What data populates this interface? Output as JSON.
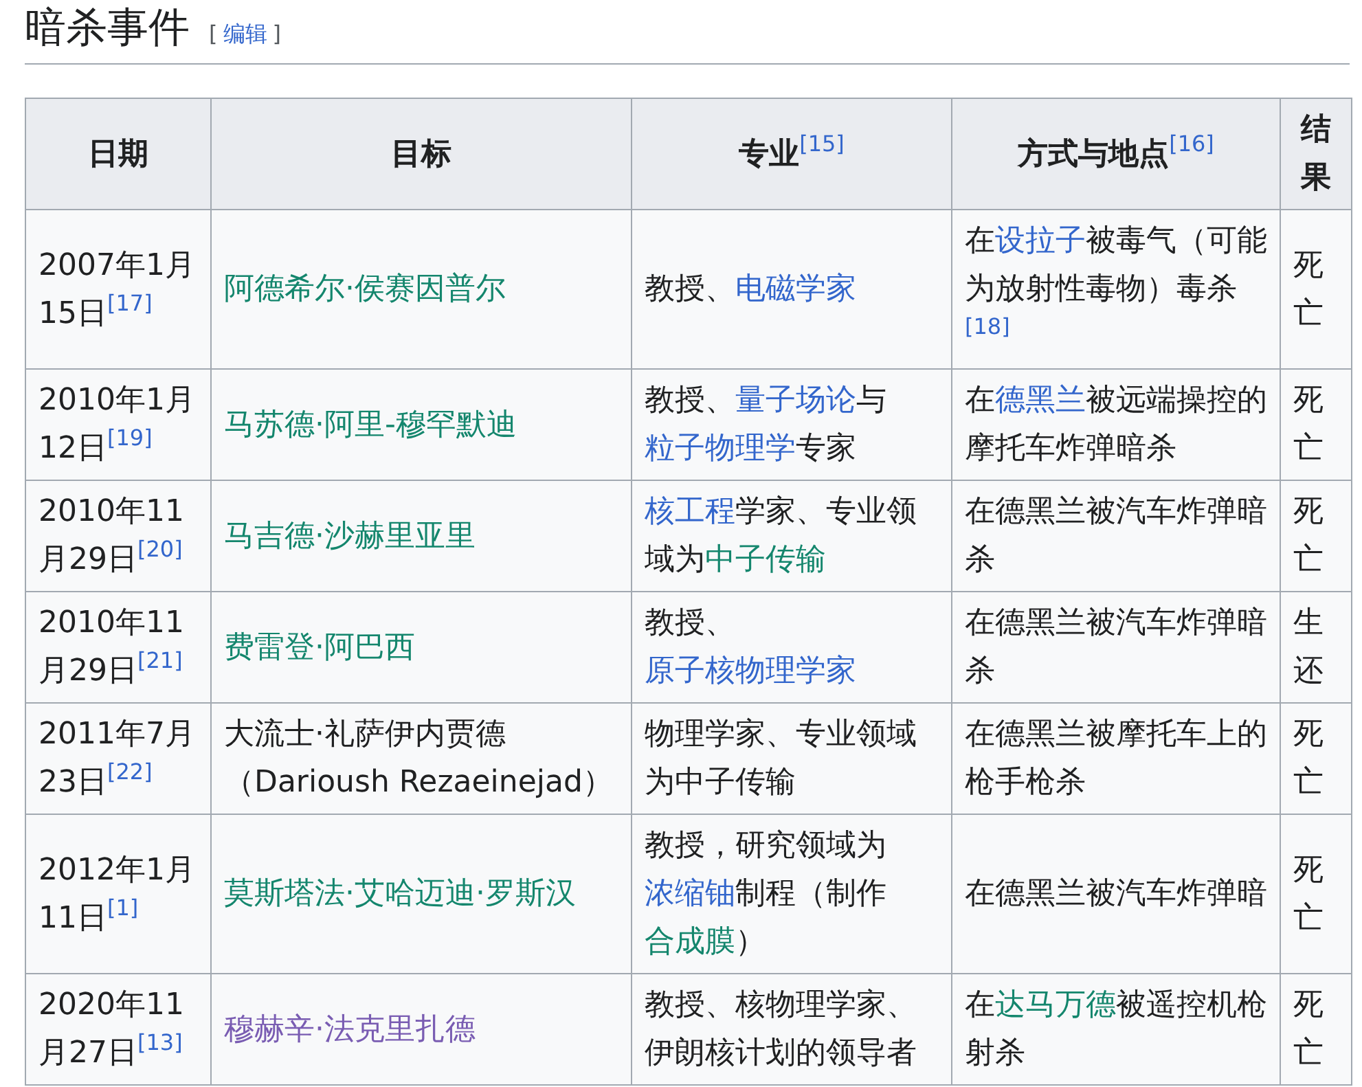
{
  "heading": {
    "title": "暗杀事件",
    "edit_open": "[",
    "edit": "编辑",
    "edit_close": "]"
  },
  "table": {
    "header_cells": [
      [
        {
          "kind": "text",
          "text": "日期"
        }
      ],
      [
        {
          "kind": "text",
          "text": "目标"
        }
      ],
      [
        {
          "kind": "text",
          "text": "专业"
        },
        {
          "kind": "ref",
          "text": "[15]"
        }
      ],
      [
        {
          "kind": "text",
          "text": "方式与地点"
        },
        {
          "kind": "ref",
          "text": "[16]"
        }
      ],
      [
        {
          "kind": "text",
          "text": "结果"
        }
      ]
    ],
    "rows": [
      {
        "cells": [
          [
            {
              "kind": "text",
              "text": "2007年1月15日"
            },
            {
              "kind": "ref",
              "text": "[17]"
            }
          ],
          [
            {
              "kind": "link",
              "text": "阿德希尔·侯赛因普尔",
              "color": "#14866d"
            }
          ],
          [
            {
              "kind": "text",
              "text": "教授、"
            },
            {
              "kind": "link",
              "text": "电磁学家",
              "color": "#3366cc"
            }
          ],
          [
            {
              "kind": "text",
              "text": "在"
            },
            {
              "kind": "link",
              "text": "设拉子",
              "color": "#3366cc"
            },
            {
              "kind": "text",
              "text": "被毒气（可能为放射性毒物）毒杀"
            },
            {
              "kind": "ref",
              "text": "[18]"
            }
          ],
          [
            {
              "kind": "text",
              "text": "死亡"
            }
          ]
        ]
      },
      {
        "cells": [
          [
            {
              "kind": "text",
              "text": "2010年1月12日"
            },
            {
              "kind": "ref",
              "text": "[19]"
            }
          ],
          [
            {
              "kind": "link",
              "text": "马苏德·阿里-穆罕默迪",
              "color": "#14866d"
            }
          ],
          [
            {
              "kind": "text",
              "text": "教授、"
            },
            {
              "kind": "link",
              "text": "量子场论",
              "color": "#3366cc"
            },
            {
              "kind": "text",
              "text": "与"
            },
            {
              "kind": "link",
              "text": "粒子物理学",
              "color": "#3366cc"
            },
            {
              "kind": "text",
              "text": "专家"
            }
          ],
          [
            {
              "kind": "text",
              "text": "在"
            },
            {
              "kind": "link",
              "text": "德黑兰",
              "color": "#3366cc"
            },
            {
              "kind": "text",
              "text": "被远端操控的摩托车炸弹暗杀"
            }
          ],
          [
            {
              "kind": "text",
              "text": "死亡"
            }
          ]
        ]
      },
      {
        "cells": [
          [
            {
              "kind": "text",
              "text": "2010年11月29日"
            },
            {
              "kind": "ref",
              "text": "[20]"
            }
          ],
          [
            {
              "kind": "link",
              "text": "马吉德·沙赫里亚里",
              "color": "#14866d"
            }
          ],
          [
            {
              "kind": "link",
              "text": "核工程",
              "color": "#3366cc"
            },
            {
              "kind": "text",
              "text": "学家、专业领域为"
            },
            {
              "kind": "link",
              "text": "中子传输",
              "color": "#14866d"
            }
          ],
          [
            {
              "kind": "text",
              "text": "在德黑兰被汽车炸弹暗杀"
            }
          ],
          [
            {
              "kind": "text",
              "text": "死亡"
            }
          ]
        ]
      },
      {
        "cells": [
          [
            {
              "kind": "text",
              "text": "2010年11月29日"
            },
            {
              "kind": "ref",
              "text": "[21]"
            }
          ],
          [
            {
              "kind": "link",
              "text": "费雷登·阿巴西",
              "color": "#14866d"
            }
          ],
          [
            {
              "kind": "text",
              "text": "教授、"
            },
            {
              "kind": "link",
              "text": "原子核物理学家",
              "color": "#3366cc"
            }
          ],
          [
            {
              "kind": "text",
              "text": "在德黑兰被汽车炸弹暗杀"
            }
          ],
          [
            {
              "kind": "text",
              "text": "生还"
            }
          ]
        ]
      },
      {
        "cells": [
          [
            {
              "kind": "text",
              "text": "2011年7月23日"
            },
            {
              "kind": "ref",
              "text": "[22]"
            }
          ],
          [
            {
              "kind": "text",
              "text": "大流士·礼萨伊内贾德（Darioush Rezaeinejad）"
            }
          ],
          [
            {
              "kind": "text",
              "text": "物理学家、专业领域为中子传输"
            }
          ],
          [
            {
              "kind": "text",
              "text": "在德黑兰被摩托车上的枪手枪杀"
            }
          ],
          [
            {
              "kind": "text",
              "text": "死亡"
            }
          ]
        ]
      },
      {
        "cells": [
          [
            {
              "kind": "text",
              "text": "2012年1月11日"
            },
            {
              "kind": "ref",
              "text": "[1]"
            }
          ],
          [
            {
              "kind": "link",
              "text": "莫斯塔法·艾哈迈迪·罗斯汉",
              "color": "#14866d"
            }
          ],
          [
            {
              "kind": "text",
              "text": "教授，研究领域为"
            },
            {
              "kind": "link",
              "text": "浓缩铀",
              "color": "#3366cc"
            },
            {
              "kind": "text",
              "text": "制程（制作"
            },
            {
              "kind": "link",
              "text": "合成膜",
              "color": "#14866d"
            },
            {
              "kind": "text",
              "text": "）"
            }
          ],
          [
            {
              "kind": "text",
              "text": "在德黑兰被汽车炸弹暗"
            }
          ],
          [
            {
              "kind": "text",
              "text": "死亡"
            }
          ]
        ]
      },
      {
        "cells": [
          [
            {
              "kind": "text",
              "text": "2020年11月27日"
            },
            {
              "kind": "ref",
              "text": "[13]"
            }
          ],
          [
            {
              "kind": "link",
              "text": "穆赫辛·法克里扎德",
              "color": "#795cb2"
            }
          ],
          [
            {
              "kind": "text",
              "text": "教授、核物理学家、伊朗核计划的领导者"
            }
          ],
          [
            {
              "kind": "text",
              "text": "在"
            },
            {
              "kind": "link",
              "text": "达马万德",
              "color": "#14866d"
            },
            {
              "kind": "text",
              "text": "被遥控机枪射杀"
            }
          ],
          [
            {
              "kind": "text",
              "text": "死亡"
            }
          ]
        ]
      }
    ]
  }
}
